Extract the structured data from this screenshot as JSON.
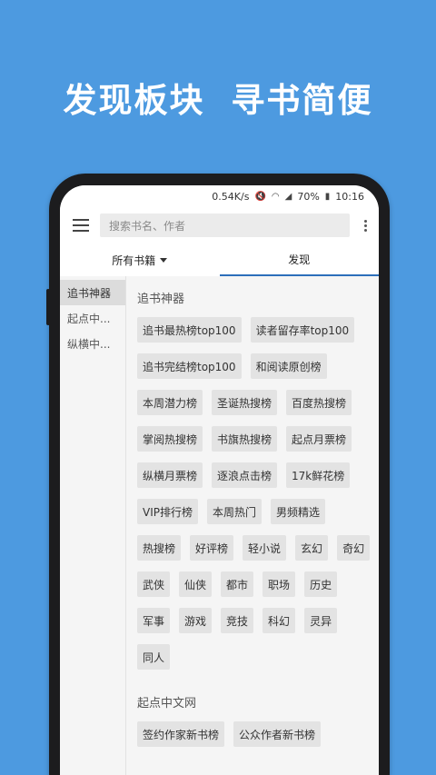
{
  "headline": "发现板块  寻书简便",
  "status_bar": {
    "speed": "0.54K/s",
    "battery": "70%",
    "time": "10:16"
  },
  "search": {
    "placeholder": "搜索书名、作者"
  },
  "tabs": [
    {
      "label": "所有书籍",
      "has_dropdown": true,
      "active": false
    },
    {
      "label": "发现",
      "active": true
    }
  ],
  "sidebar": {
    "items": [
      {
        "label": "追书神器",
        "active": true
      },
      {
        "label": "起点中...",
        "active": false
      },
      {
        "label": "纵横中...",
        "active": false
      }
    ]
  },
  "sections": [
    {
      "title": "追书神器",
      "chips": [
        "追书最热榜top100",
        "读者留存率top100",
        "追书完结榜top100",
        "和阅读原创榜",
        "本周潜力榜",
        "圣诞热搜榜",
        "百度热搜榜",
        "掌阅热搜榜",
        "书旗热搜榜",
        "起点月票榜",
        "纵横月票榜",
        "逐浪点击榜",
        "17k鲜花榜",
        "VIP排行榜",
        "本周热门",
        "男频精选",
        "热搜榜",
        "好评榜",
        "轻小说",
        "玄幻",
        "奇幻",
        "武侠",
        "仙侠",
        "都市",
        "职场",
        "历史",
        "军事",
        "游戏",
        "竞技",
        "科幻",
        "灵异",
        "同人"
      ]
    },
    {
      "title": "起点中文网",
      "chips": [
        "签约作家新书榜",
        "公众作者新书榜"
      ]
    }
  ],
  "colors": {
    "background": "#4d9ae0",
    "tab_indicator": "#2c6fba"
  }
}
